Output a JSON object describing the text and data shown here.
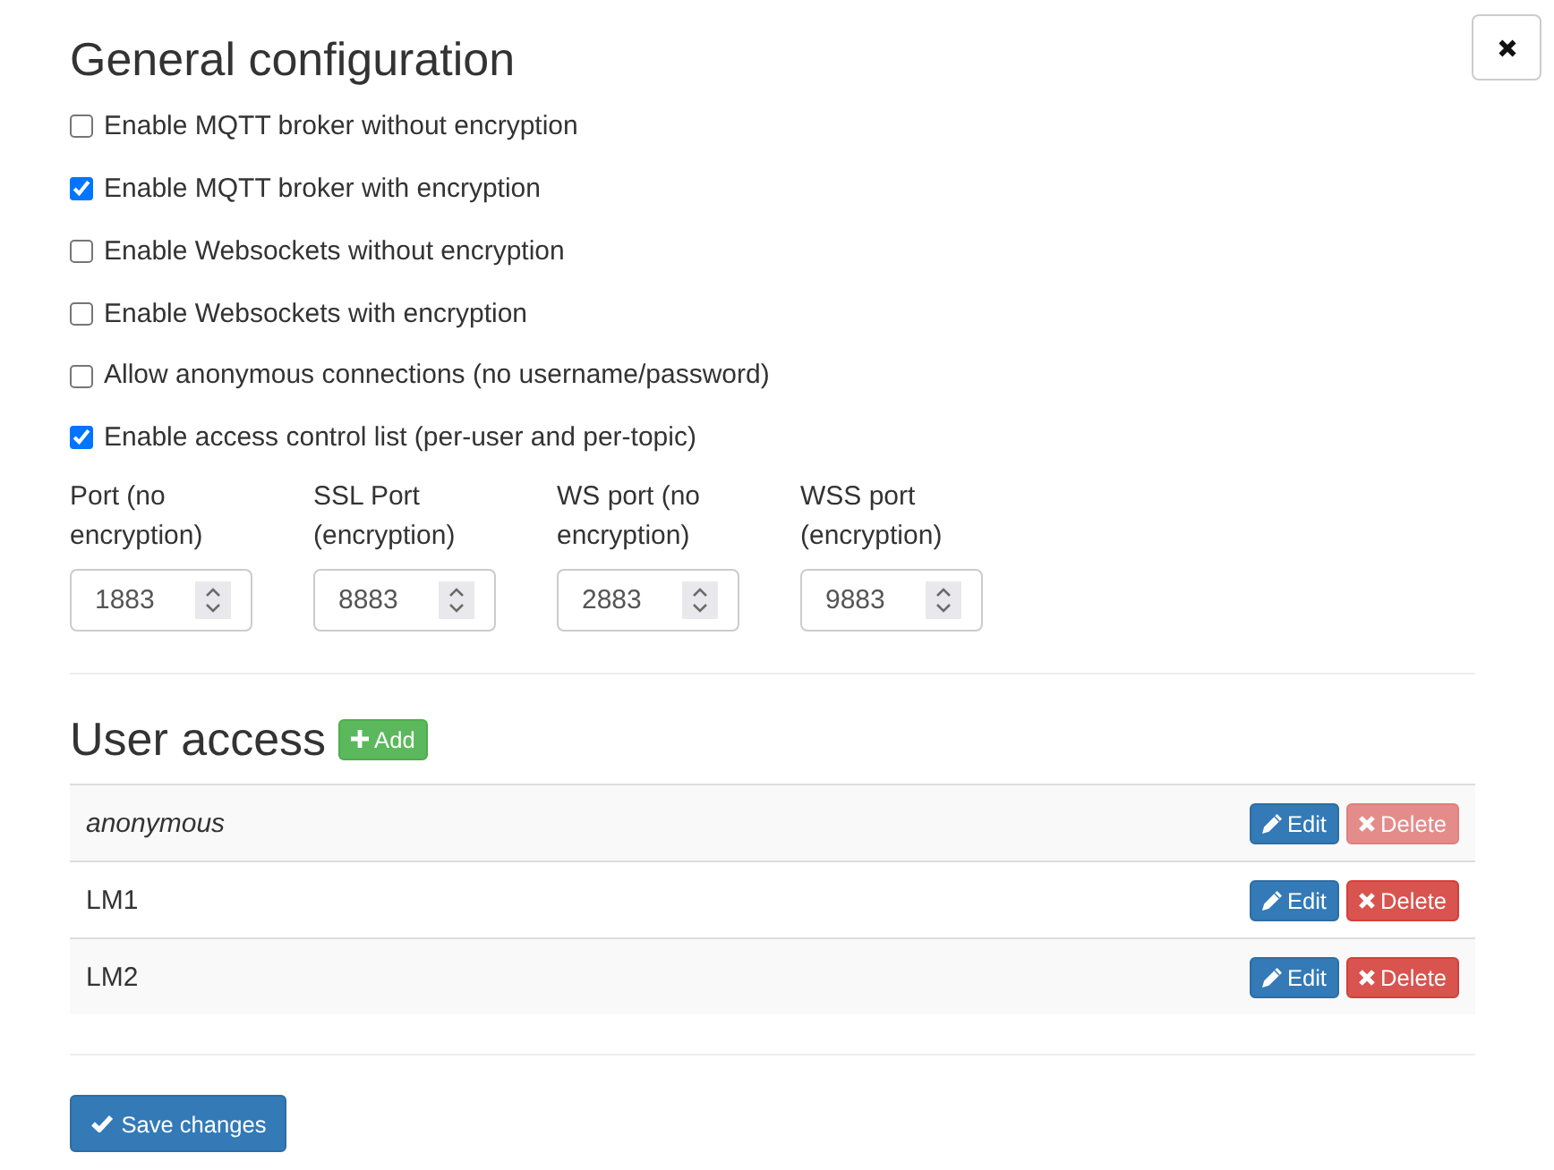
{
  "title": "General configuration",
  "options": [
    {
      "label": "Enable MQTT broker without encryption",
      "checked": false
    },
    {
      "label": "Enable MQTT broker with encryption",
      "checked": true
    },
    {
      "label": "Enable Websockets without encryption",
      "checked": false
    },
    {
      "label": "Enable Websockets with encryption",
      "checked": false
    },
    {
      "label": "Allow anonymous connections (no username/password)",
      "checked": false
    },
    {
      "label": "Enable access control list (per-user and per-topic)",
      "checked": true
    }
  ],
  "ports": [
    {
      "label": "Port (no encryption)",
      "value": "1883"
    },
    {
      "label": "SSL Port (encryption)",
      "value": "8883"
    },
    {
      "label": "WS port (no encryption)",
      "value": "2883"
    },
    {
      "label": "WSS port (encryption)",
      "value": "9883"
    }
  ],
  "user_access": {
    "title": "User access",
    "add_button": "Add",
    "users": [
      {
        "name": "anonymous",
        "kind": "builtin",
        "edit_button": "Edit",
        "delete_button": "Delete",
        "delete_disabled": true
      },
      {
        "name": "LM1",
        "kind": "user",
        "edit_button": "Edit",
        "delete_button": "Delete",
        "delete_disabled": false
      },
      {
        "name": "LM2",
        "kind": "user",
        "edit_button": "Edit",
        "delete_button": "Delete",
        "delete_disabled": false
      }
    ]
  },
  "save_button": "Save changes"
}
